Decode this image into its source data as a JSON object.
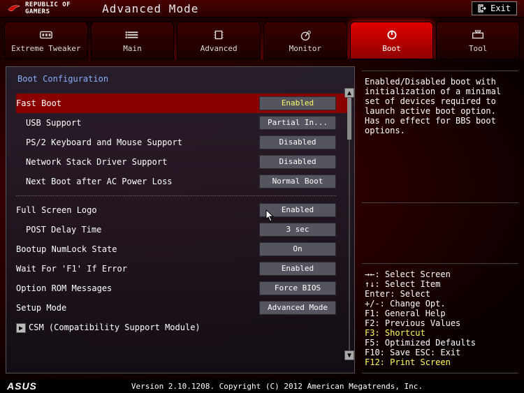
{
  "topbar": {
    "brand_line1": "REPUBLIC OF",
    "brand_line2": "GAMERS",
    "title": "Advanced Mode",
    "exit_label": "Exit"
  },
  "tabs": [
    {
      "label": "Extreme Tweaker"
    },
    {
      "label": "Main"
    },
    {
      "label": "Advanced"
    },
    {
      "label": "Monitor"
    },
    {
      "label": "Boot"
    },
    {
      "label": "Tool"
    }
  ],
  "active_tab_index": 4,
  "panel": {
    "title": "Boot Configuration",
    "rows": [
      {
        "label": "Fast Boot",
        "value": "Enabled",
        "selected": true,
        "hl": true
      },
      {
        "label": "USB Support",
        "value": "Partial In...",
        "sub": true
      },
      {
        "label": "PS/2 Keyboard and Mouse Support",
        "value": "Disabled",
        "sub": true
      },
      {
        "label": "Network Stack Driver Support",
        "value": "Disabled",
        "sub": true
      },
      {
        "label": "Next Boot after AC Power Loss",
        "value": "Normal Boot",
        "sub": true
      },
      {
        "separator": true
      },
      {
        "label": "Full Screen Logo",
        "value": "Enabled"
      },
      {
        "label": "POST Delay Time",
        "value": "3 sec",
        "sub": true
      },
      {
        "label": "Bootup NumLock State",
        "value": "On"
      },
      {
        "label": "Wait For 'F1' If Error",
        "value": "Enabled"
      },
      {
        "label": "Option ROM Messages",
        "value": "Force BIOS"
      },
      {
        "label": "Setup Mode",
        "value": "Advanced Mode"
      },
      {
        "label": "CSM (Compatibility Support Module)",
        "submenu": true
      }
    ]
  },
  "help": {
    "description": "Enabled/Disabled boot with initialization of a minimal set of devices required to launch active boot option. Has no effect for BBS boot options.",
    "keys": [
      {
        "text": "→←: Select Screen"
      },
      {
        "text": "↑↓: Select Item"
      },
      {
        "text": "Enter: Select"
      },
      {
        "text": "+/-: Change Opt."
      },
      {
        "text": "F1: General Help"
      },
      {
        "text": "F2: Previous Values"
      },
      {
        "text": "F3: Shortcut",
        "hl": true
      },
      {
        "text": "F5: Optimized Defaults"
      },
      {
        "text": "F10: Save   ESC: Exit"
      },
      {
        "text": "F12: Print Screen",
        "hl": true
      }
    ]
  },
  "footer": {
    "brand": "ASUS",
    "text": "Version 2.10.1208. Copyright (C) 2012 American Megatrends, Inc."
  }
}
